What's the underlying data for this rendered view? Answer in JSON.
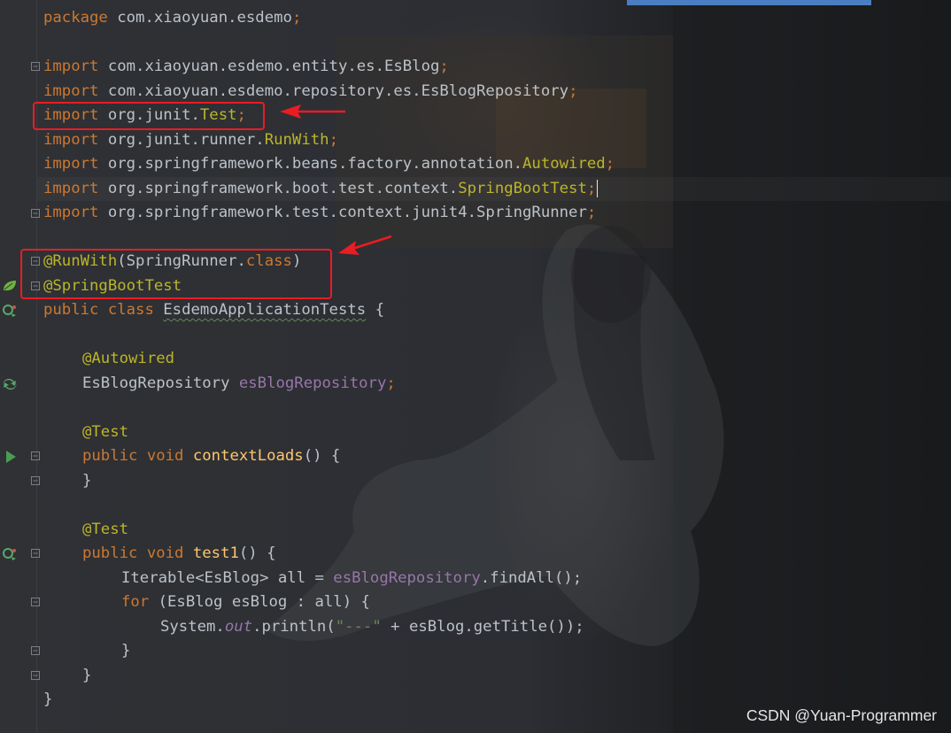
{
  "editor": {
    "lines": {
      "package_kw": "package",
      "package_name": " com.xiaoyuan.esdemo",
      "semi": ";",
      "import_kw": "import",
      "imp1": " com.xiaoyuan.esdemo.entity.es.EsBlog",
      "imp2": " com.xiaoyuan.esdemo.repository.es.EsBlogRepository",
      "imp3_pre": " org.junit.",
      "imp3_cls": "Test",
      "imp4_pre": " org.junit.runner.",
      "imp4_cls": "RunWith",
      "imp5_pre": " org.springframework.beans.factory.annotation.",
      "imp5_cls": "Autowired",
      "imp6_pre": " org.springframework.boot.test.context.",
      "imp6_cls": "SpringBootTest",
      "imp7": " org.springframework.test.context.junit4.SpringRunner",
      "ann_runwith": "@RunWith",
      "runwith_arg_open": "(SpringRunner.",
      "class_kw": "class",
      "close_paren": ")",
      "ann_springboottest": "@SpringBootTest",
      "public_class_kw": "public class ",
      "class_name": "EsdemoApplicationTests",
      "open_brace": " {",
      "ann_autowired": "@Autowired",
      "field_type": "EsBlogRepository ",
      "field_name": "esBlogRepository",
      "ann_test": "@Test",
      "public_void_kw": "public void ",
      "method1": "contextLoads",
      "method_sig_tail": "() {",
      "close_brace": "}",
      "method2": "test1",
      "iter_decl": "Iterable<EsBlog> all = ",
      "find_all": ".findAll();",
      "for_kw": "for",
      "for_rest": " (EsBlog esBlog : all) {",
      "sys_pre": "System.",
      "sys_out": "out",
      "println_open": ".println(",
      "str_lit": "\"---\"",
      "println_rest": " + esBlog.getTitle());"
    }
  },
  "watermark": "CSDN @Yuan-Programmer",
  "colors": {
    "highlight_box": "#ea1c24",
    "keyword": "#cc7832",
    "annotation": "#bbb529",
    "field": "#9876aa",
    "string": "#6a8759",
    "method": "#ffc66d",
    "text": "#bcc2c8"
  },
  "icons": {
    "spring_bean": "spring-leaf-icon",
    "run_test": "run-icon",
    "rerun": "rerun-icon",
    "fold": "fold-icon"
  }
}
